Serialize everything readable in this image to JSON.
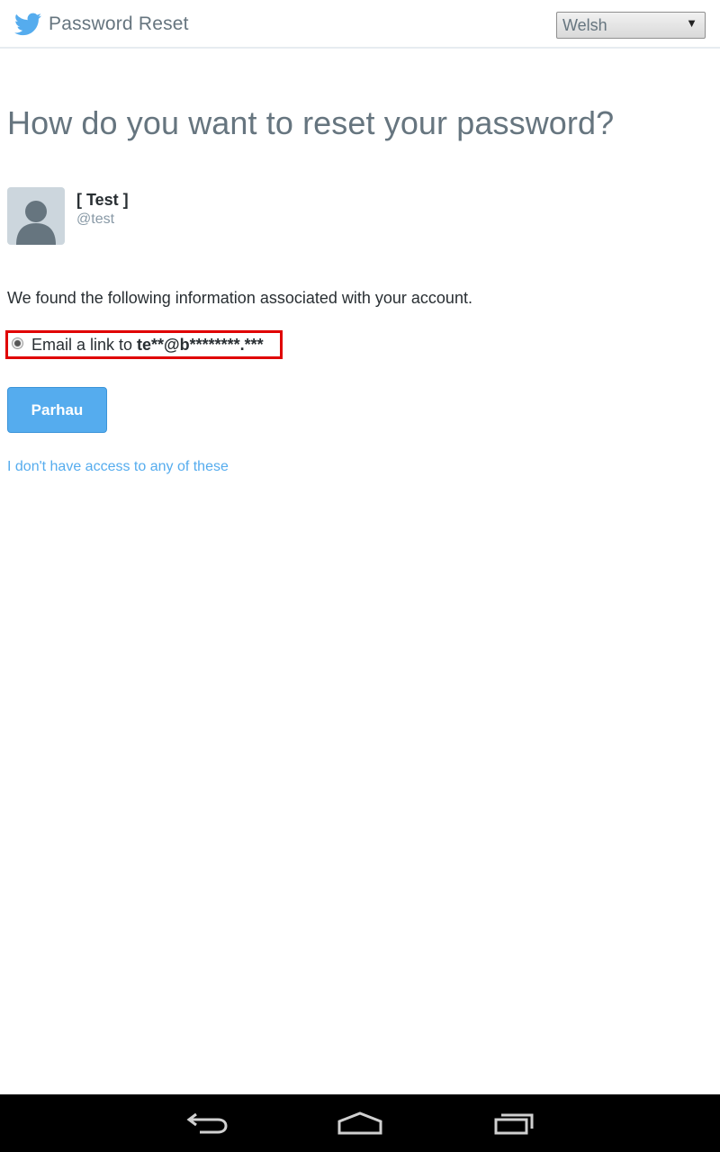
{
  "header": {
    "title": "Password Reset",
    "language": {
      "selected": "Welsh"
    }
  },
  "main": {
    "heading": "How do you want to reset your password?",
    "user": {
      "name": "[ Test ]",
      "handle": "@test"
    },
    "info": "We found the following information associated with your account.",
    "option": {
      "prefix": "Email a link to ",
      "email": "te**@b********.***",
      "selected": true
    },
    "continue_label": "Parhau",
    "no_access_link": "I don't have access to any of these"
  },
  "colors": {
    "brand": "#55acee",
    "highlight": "#e00000",
    "heading": "#66757f"
  },
  "icons": {
    "logo": "twitter-bird-icon",
    "dropdown": "triangle-down-icon",
    "avatar": "default-user-icon",
    "nav": [
      "back-icon",
      "home-icon",
      "recent-apps-icon"
    ]
  }
}
